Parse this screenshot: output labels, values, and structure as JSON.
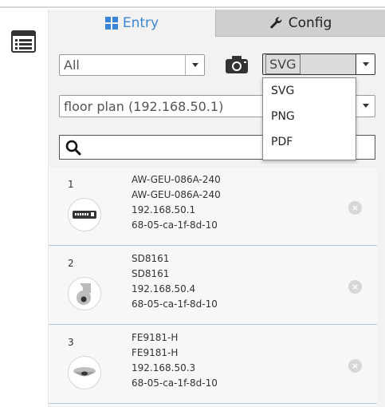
{
  "tabs": {
    "entry_label": "Entry",
    "config_label": "Config"
  },
  "filter_select": {
    "value": "All"
  },
  "export_format": {
    "value": "SVG",
    "options": [
      "SVG",
      "PNG",
      "PDF"
    ]
  },
  "floor_select": {
    "value": "floor plan (192.168.50.1)"
  },
  "search": {
    "placeholder": "",
    "value": ""
  },
  "devices": [
    {
      "index": "1",
      "name": "AW-GEU-086A-240",
      "model": "AW-GEU-086A-240",
      "ip": "192.168.50.1",
      "mac": "68-05-ca-1f-8d-10",
      "icon": "network-switch-icon"
    },
    {
      "index": "2",
      "name": "SD8161",
      "model": "SD8161",
      "ip": "192.168.50.4",
      "mac": "68-05-ca-1f-8d-10",
      "icon": "speed-dome-camera-icon"
    },
    {
      "index": "3",
      "name": "FE9181-H",
      "model": "FE9181-H",
      "ip": "192.168.50.3",
      "mac": "68-05-ca-1f-8d-10",
      "icon": "fisheye-camera-icon"
    }
  ],
  "colors": {
    "accent": "#3a86d4",
    "row_divider": "#aac9e6",
    "panel_bg": "#f2f2f2"
  }
}
